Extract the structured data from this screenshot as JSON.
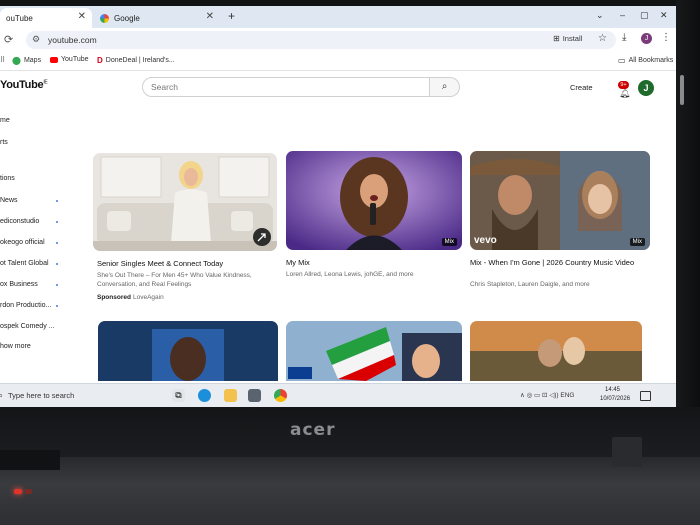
{
  "browser": {
    "tabs": [
      {
        "label": "ouTube"
      },
      {
        "label": "Google"
      }
    ],
    "new_tab": "+",
    "window_controls": [
      "⌄",
      "–",
      "▢",
      "✕"
    ],
    "url": "youtube.com",
    "install_label": "Install"
  },
  "bookmarks": {
    "items": [
      {
        "label": "Maps"
      },
      {
        "label": "YouTube"
      },
      {
        "label": "DoneDeal | Ireland's..."
      }
    ],
    "all_bookmarks": "All Bookmarks"
  },
  "youtube": {
    "logo": "YouTube",
    "logo_sup": "IE",
    "search_placeholder": "Search",
    "create_label": "Create",
    "notification_count": "9+",
    "avatar_letter": "J"
  },
  "sidebar": {
    "items": [
      {
        "label": "me"
      },
      {
        "label": "rts"
      },
      {
        "label": "tions"
      },
      {
        "label": "News"
      },
      {
        "label": "ediconstudio"
      },
      {
        "label": "okeogo official"
      },
      {
        "label": "ot Talent Global"
      },
      {
        "label": "ox Business"
      },
      {
        "label": "rdon Productio..."
      },
      {
        "label": "ospek Comedy ..."
      },
      {
        "label": "how more"
      }
    ]
  },
  "videos": [
    {
      "title": "Senior Singles Meet & Connect Today",
      "description": "She's Out There – For Men 45+ Who Value Kindness, Conversation, and Real Feelings",
      "sponsored": "Sponsored",
      "advertiser": "LoveAgain"
    },
    {
      "title": "My Mix",
      "meta": "Loren Allred, Leona Lewis, johGE, and more",
      "badge": "Mix"
    },
    {
      "title": "Mix - When I'm Gone | 2026 Country Music Video",
      "meta": "Chris Stapleton, Lauren Daigle, and more",
      "badge": "Mix",
      "vevo": "vevo"
    }
  ],
  "taskbar": {
    "search_placeholder": "Type here to search",
    "tray": "∧  ◎  ▭  ⊡  ◁))  ENG",
    "time": "14:45",
    "date": "10/07/2026"
  },
  "laptop": {
    "brand": "acer"
  },
  "colors": {
    "accent": "#3d7fe0",
    "youtube_red": "#ff0000",
    "tabbar_bg": "#dfe8f2"
  }
}
